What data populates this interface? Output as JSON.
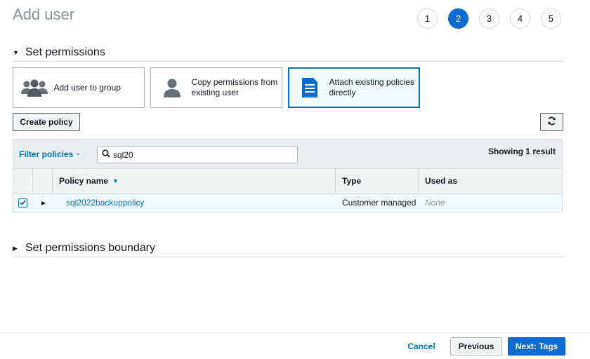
{
  "page": {
    "title": "Add user"
  },
  "steps": [
    "1",
    "2",
    "3",
    "4",
    "5"
  ],
  "active_step": "2",
  "permissions": {
    "section_label": "Set permissions",
    "options": {
      "group": "Add user to group",
      "copy": "Copy permissions from existing user",
      "attach": "Attach existing policies directly"
    },
    "selected_option": "attach",
    "create_policy_label": "Create policy"
  },
  "filter": {
    "label": "Filter policies",
    "search_value": "sql20",
    "showing": "Showing 1 result"
  },
  "table": {
    "columns": {
      "name": "Policy name",
      "type": "Type",
      "used_as": "Used as"
    },
    "rows": [
      {
        "name": "sql2022backuppolicy",
        "type": "Customer managed",
        "used_as": "None",
        "checked": true
      }
    ]
  },
  "boundary": {
    "section_label": "Set permissions boundary"
  },
  "footer": {
    "cancel": "Cancel",
    "previous": "Previous",
    "next": "Next: Tags"
  },
  "colors": {
    "accent": "#0f6bd0",
    "link": "#0073bb",
    "selected_bg": "#f1faff"
  }
}
